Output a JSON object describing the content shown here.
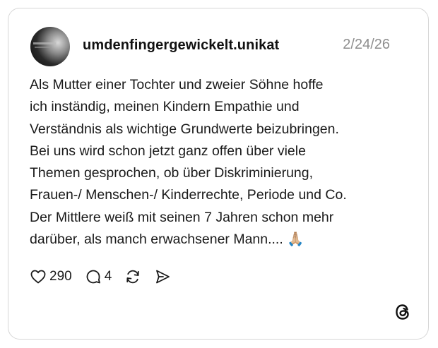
{
  "post": {
    "username": "umdenfingergewickelt.unikat",
    "date": "2/24/26",
    "text": "Als Mutter einer Tochter und zweier Söhne hoffe\nich inständig, meinen Kindern Empathie und\nVerständnis als wichtige Grundwerte beizubringen.\nBei uns wird schon jetzt ganz offen über viele\nThemen gesprochen, ob über Diskriminierung,\nFrauen-/ Menschen-/ Kinderrechte, Periode und Co.\nDer Mittlere weiß mit seinen 7 Jahren schon mehr\ndarüber, als manch erwachsener Mann.... 🙏🏼",
    "likes": "290",
    "comments": "4"
  },
  "icons": {
    "avatar": "profile-avatar",
    "like": "heart-icon",
    "comment": "comment-bubble-icon",
    "repost": "repost-icon",
    "share": "send-icon",
    "brand": "threads-logo-icon"
  }
}
